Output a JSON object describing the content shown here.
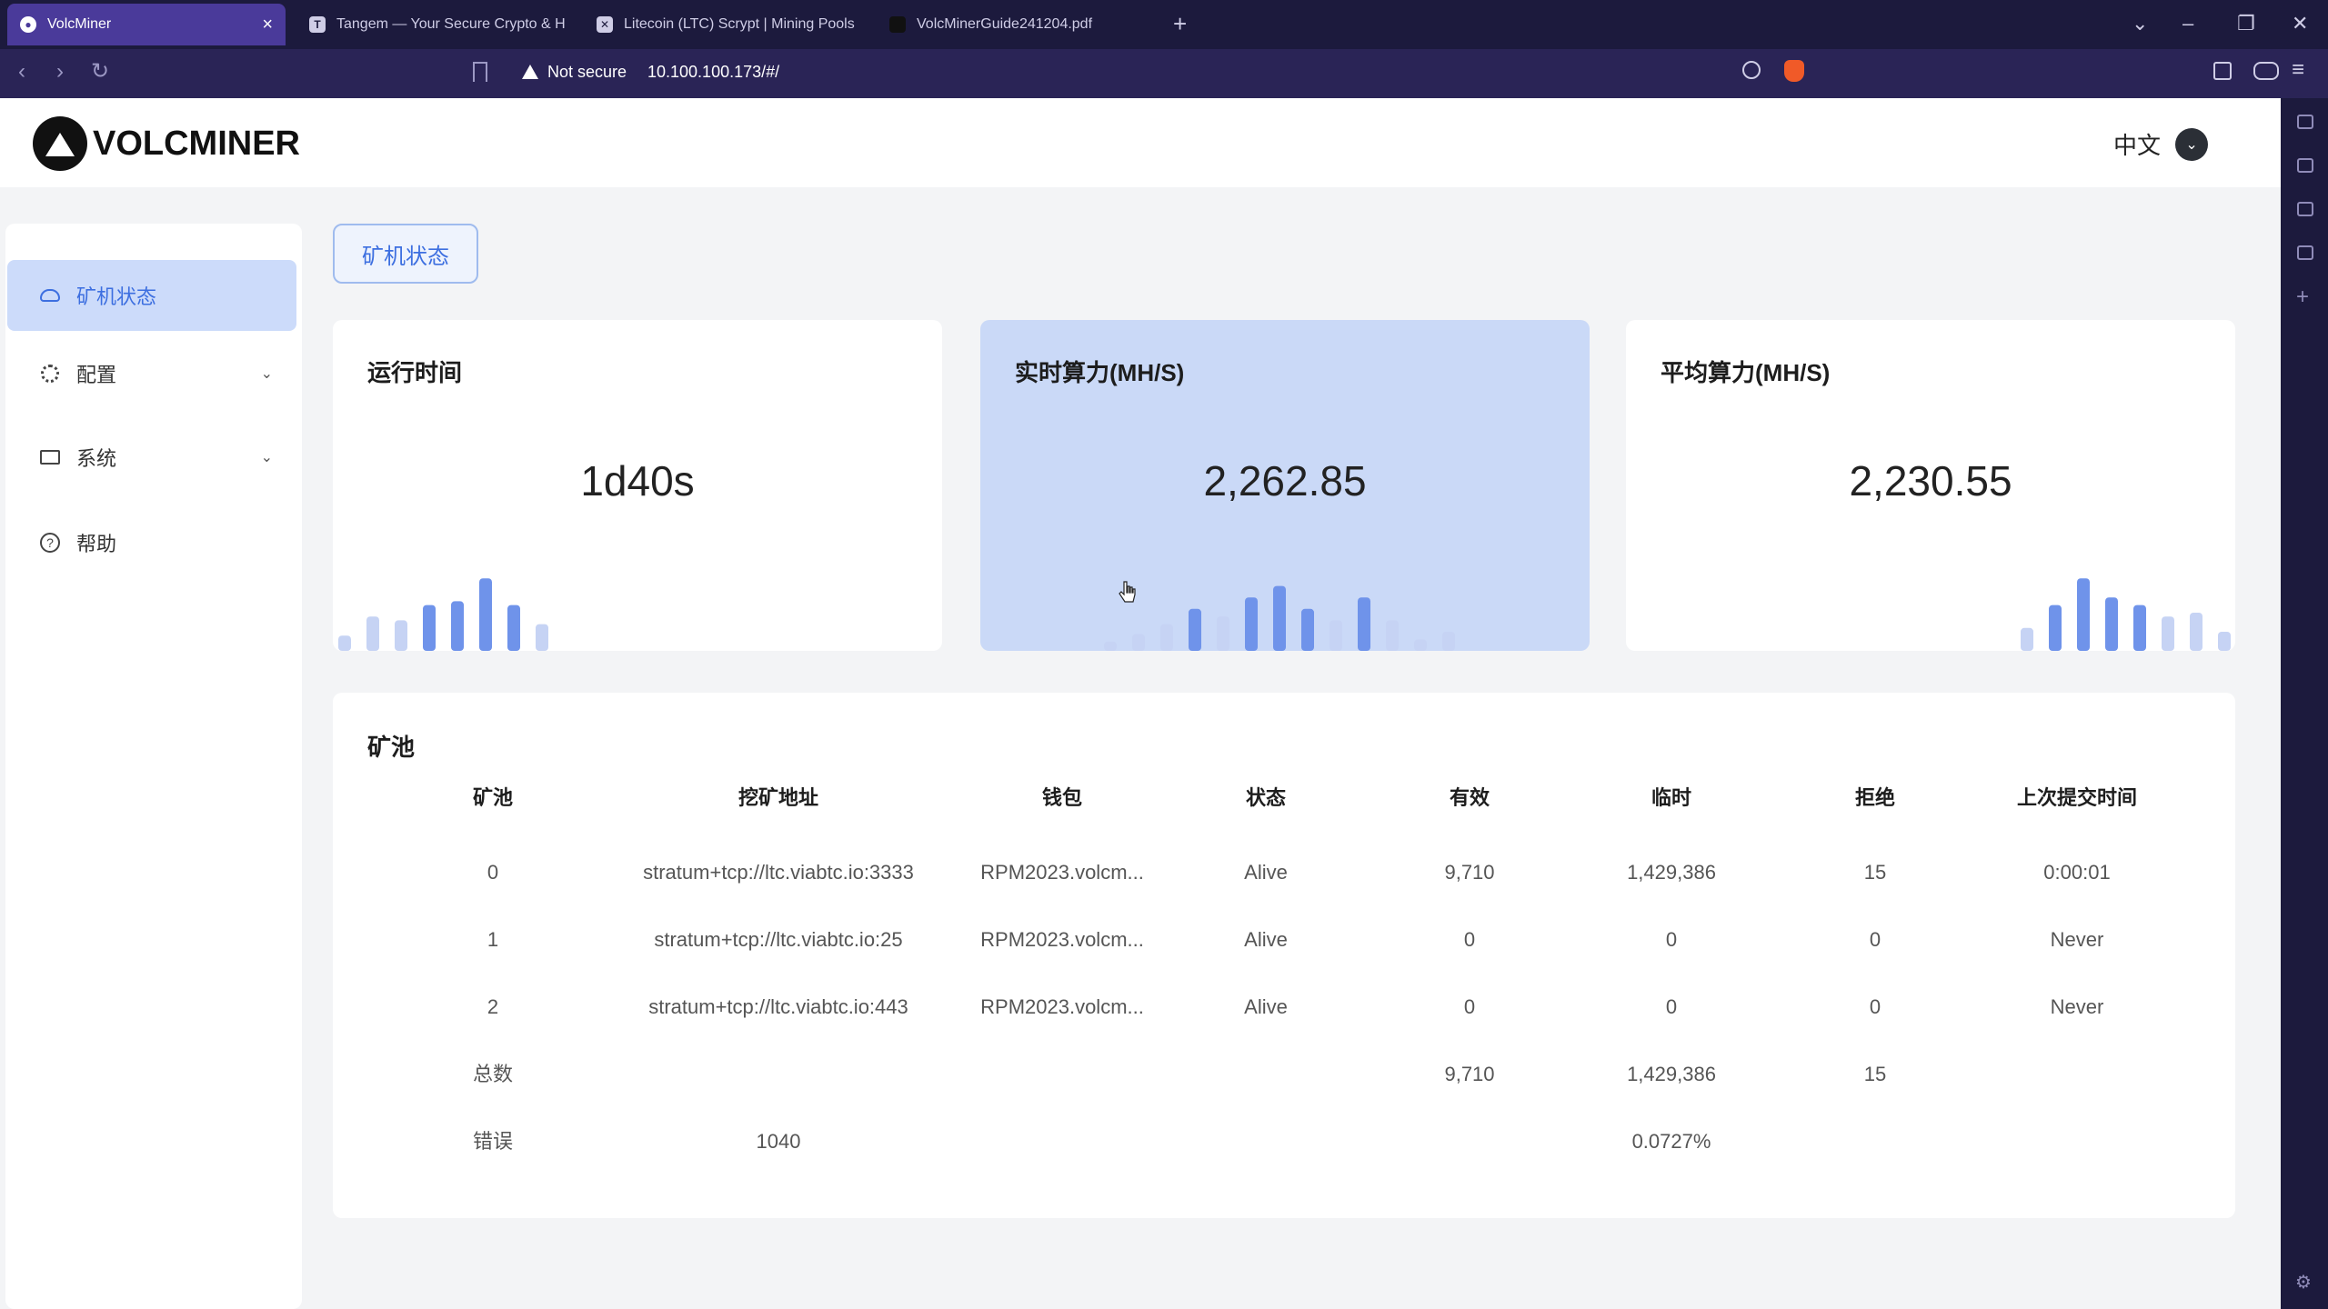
{
  "browser": {
    "tabs": [
      {
        "title": "VolcMiner",
        "active": true,
        "icon": "volcminer-favicon"
      },
      {
        "title": "Tangem — Your Secure Crypto & H",
        "active": false,
        "icon": "tangem-favicon"
      },
      {
        "title": "Litecoin (LTC) Scrypt | Mining Pools",
        "active": false,
        "icon": "litecoin-favicon"
      },
      {
        "title": "VolcMinerGuide241204.pdf",
        "active": false,
        "icon": "pdf-favicon"
      }
    ],
    "security_label": "Not secure",
    "url": "10.100.100.173/#/"
  },
  "header": {
    "logo_text": "VOLCMINER",
    "language": "中文"
  },
  "sidebar": {
    "items": [
      {
        "label": "矿机状态",
        "icon": "cloud-icon",
        "active": true,
        "expandable": false
      },
      {
        "label": "配置",
        "icon": "gear-icon",
        "active": false,
        "expandable": true
      },
      {
        "label": "系统",
        "icon": "monitor-icon",
        "active": false,
        "expandable": true
      },
      {
        "label": "帮助",
        "icon": "help-icon",
        "active": false,
        "expandable": false
      }
    ]
  },
  "breadcrumb": {
    "label": "矿机状态"
  },
  "cards": [
    {
      "title": "运行时间",
      "value": "1d40s",
      "highlight": false,
      "bars": [
        0.2,
        0.45,
        0.4,
        0.6,
        0.65,
        0.95,
        0.6,
        0.35
      ]
    },
    {
      "title": "实时算力(MH/S)",
      "value": "2,262.85",
      "highlight": true,
      "bars": [
        0.12,
        0.22,
        0.35,
        0.55,
        0.45,
        0.7,
        0.85,
        0.55,
        0.4,
        0.7,
        0.4,
        0.15,
        0.25
      ]
    },
    {
      "title": "平均算力(MH/S)",
      "value": "2,230.55",
      "highlight": false,
      "bars": [
        0.3,
        0.6,
        0.95,
        0.7,
        0.6,
        0.45,
        0.5,
        0.25
      ]
    }
  ],
  "pools": {
    "title": "矿池",
    "columns": [
      "矿池",
      "挖矿地址",
      "钱包",
      "状态",
      "有效",
      "临时",
      "拒绝",
      "上次提交时间"
    ],
    "rows": [
      [
        "0",
        "stratum+tcp://ltc.viabtc.io:3333",
        "RPM2023.volcm...",
        "Alive",
        "9,710",
        "1,429,386",
        "15",
        "0:00:01"
      ],
      [
        "1",
        "stratum+tcp://ltc.viabtc.io:25",
        "RPM2023.volcm...",
        "Alive",
        "0",
        "0",
        "0",
        "Never"
      ],
      [
        "2",
        "stratum+tcp://ltc.viabtc.io:443",
        "RPM2023.volcm...",
        "Alive",
        "0",
        "0",
        "0",
        "Never"
      ]
    ],
    "total": [
      "总数",
      "",
      "",
      "",
      "9,710",
      "1,429,386",
      "15",
      ""
    ],
    "error": [
      "错误",
      "1040",
      "",
      "",
      "",
      "0.0727%",
      "",
      ""
    ]
  },
  "progress": {
    "fraction": 1.0
  },
  "colors": {
    "accent": "#3d6fe0",
    "bar_light": "#c6d3f4",
    "bar_dark": "#6f93ea",
    "highlight_card": "#cad9f7"
  }
}
